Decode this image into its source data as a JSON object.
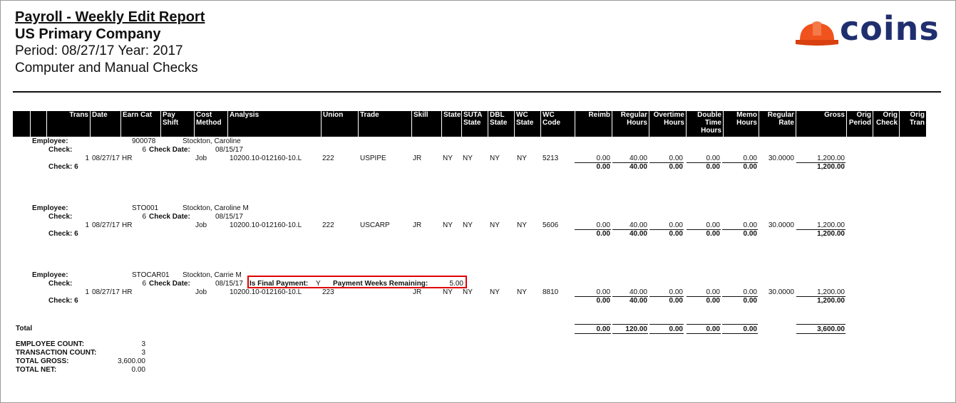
{
  "report": {
    "title": "Payroll - Weekly Edit Report",
    "company": "US Primary Company",
    "period_line": "Period: 08/27/17 Year: 2017",
    "subtitle": "Computer and Manual Checks"
  },
  "logo": {
    "text": "coins",
    "icon": "hard-hat-icon",
    "hat_color": "#f0531e",
    "text_color": "#1f2f6e"
  },
  "columns": [
    "",
    "",
    "Trans",
    "Date",
    "Earn Cat",
    "Pay Shift",
    "Cost Method",
    "Analysis",
    "Union",
    "Trade",
    "Skill",
    "State",
    "SUTA State",
    "DBL State",
    "WC State",
    "WC Code",
    "Reimb",
    "Regular Hours",
    "Overtime Hours",
    "Double Time Hours",
    "Memo Hours",
    "Regular Rate",
    "Gross",
    "Orig Period",
    "Orig Check",
    "Orig Tran"
  ],
  "labels": {
    "employee": "Employee:",
    "check": "Check:",
    "check_date": "Check Date:",
    "is_final_payment": "Is Final Payment:",
    "payment_weeks_remaining": "Payment Weeks Remaining:",
    "total": "Total"
  },
  "employees": [
    {
      "id": "900078",
      "name": "Stockton, Caroline",
      "check_no": "6",
      "check_date": "08/15/17",
      "line": {
        "trans": "1",
        "date": "08/27/17",
        "earn_cat": "HR",
        "cost_method": "Job",
        "analysis": "10200.10-012160-10.L",
        "union": "222",
        "trade": "USPIPE",
        "skill": "JR",
        "state": "NY",
        "suta_state": "NY",
        "dbl_state": "NY",
        "wc_state": "NY",
        "wc_code": "5213",
        "reimb": "0.00",
        "regular_hours": "40.00",
        "overtime_hours": "0.00",
        "double_time_hours": "0.00",
        "memo_hours": "0.00",
        "regular_rate": "30.0000",
        "gross": "1,200.00"
      },
      "check_total_label": "Check: 6",
      "check_total": {
        "reimb": "0.00",
        "regular_hours": "40.00",
        "overtime_hours": "0.00",
        "double_time_hours": "0.00",
        "memo_hours": "0.00",
        "gross": "1,200.00"
      }
    },
    {
      "id": "STO001",
      "name": "Stockton, Caroline M",
      "check_no": "6",
      "check_date": "08/15/17",
      "line": {
        "trans": "1",
        "date": "08/27/17",
        "earn_cat": "HR",
        "cost_method": "Job",
        "analysis": "10200.10-012160-10.L",
        "union": "222",
        "trade": "USCARP",
        "skill": "JR",
        "state": "NY",
        "suta_state": "NY",
        "dbl_state": "NY",
        "wc_state": "NY",
        "wc_code": "5606",
        "reimb": "0.00",
        "regular_hours": "40.00",
        "overtime_hours": "0.00",
        "double_time_hours": "0.00",
        "memo_hours": "0.00",
        "regular_rate": "30.0000",
        "gross": "1,200.00"
      },
      "check_total_label": "Check: 6",
      "check_total": {
        "reimb": "0.00",
        "regular_hours": "40.00",
        "overtime_hours": "0.00",
        "double_time_hours": "0.00",
        "memo_hours": "0.00",
        "gross": "1,200.00"
      }
    },
    {
      "id": "STOCAR01",
      "name": "Stockton, Carrie M",
      "check_no": "6",
      "check_date": "08/15/17",
      "is_final_payment": "Y",
      "payment_weeks_remaining": "5.00",
      "line": {
        "trans": "1",
        "date": "08/27/17",
        "earn_cat": "HR",
        "cost_method": "Job",
        "analysis": "10200.10-012160-10.L",
        "union": "223",
        "trade": "",
        "skill": "JR",
        "state": "NY",
        "suta_state": "NY",
        "dbl_state": "NY",
        "wc_state": "NY",
        "wc_code": "8810",
        "reimb": "0.00",
        "regular_hours": "40.00",
        "overtime_hours": "0.00",
        "double_time_hours": "0.00",
        "memo_hours": "0.00",
        "regular_rate": "30.0000",
        "gross": "1,200.00"
      },
      "check_total_label": "Check: 6",
      "check_total": {
        "reimb": "0.00",
        "regular_hours": "40.00",
        "overtime_hours": "0.00",
        "double_time_hours": "0.00",
        "memo_hours": "0.00",
        "gross": "1,200.00"
      }
    }
  ],
  "grand_total": {
    "reimb": "0.00",
    "regular_hours": "120.00",
    "overtime_hours": "0.00",
    "double_time_hours": "0.00",
    "memo_hours": "0.00",
    "gross": "3,600.00"
  },
  "summary": [
    {
      "label": "EMPLOYEE COUNT:",
      "value": "3"
    },
    {
      "label": "TRANSACTION COUNT:",
      "value": "3"
    },
    {
      "label": "TOTAL GROSS:",
      "value": "3,600.00"
    },
    {
      "label": "TOTAL NET:",
      "value": "0.00"
    }
  ],
  "colors": {
    "header_band": "#000000",
    "highlight_border": "#e00000"
  }
}
